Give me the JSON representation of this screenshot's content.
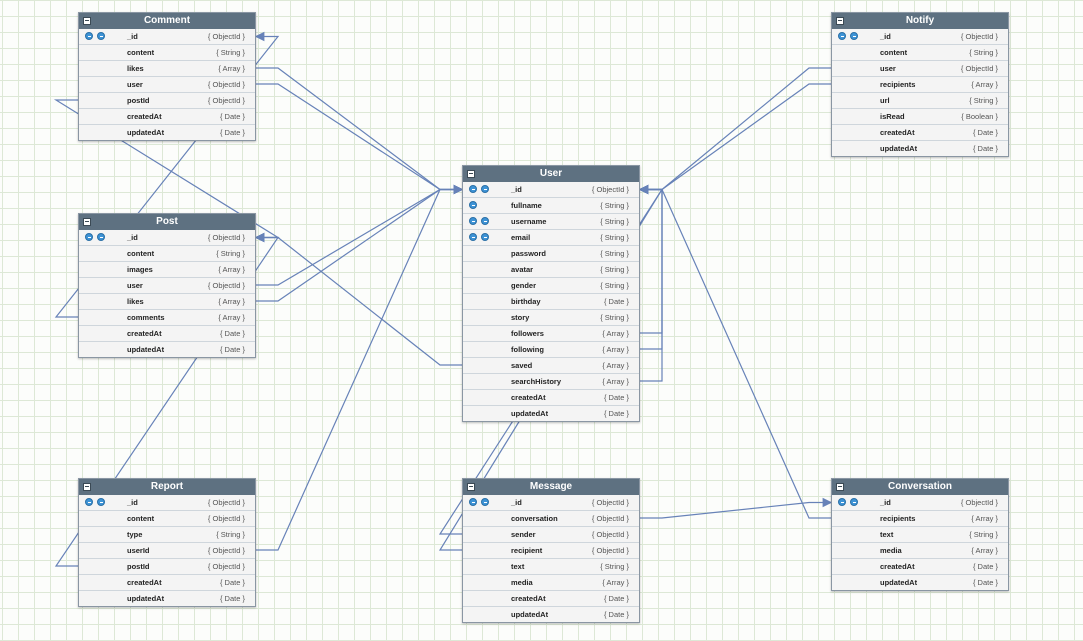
{
  "colors": {
    "header": "#5e7181",
    "wire": "#6782b8",
    "key": "#3d93d6",
    "grid": "#dde8d6"
  },
  "diagram": {
    "entities": [
      {
        "id": "comment",
        "name": "Comment",
        "fields": [
          {
            "name": "_id",
            "type": "{ ObjectId }",
            "keys": 2
          },
          {
            "name": "content",
            "type": "{ String }",
            "keys": 0
          },
          {
            "name": "likes",
            "type": "{ Array }",
            "keys": 0
          },
          {
            "name": "user",
            "type": "{ ObjectId }",
            "keys": 0
          },
          {
            "name": "postId",
            "type": "{ ObjectId }",
            "keys": 0
          },
          {
            "name": "createdAt",
            "type": "{ Date }",
            "keys": 0
          },
          {
            "name": "updatedAt",
            "type": "{ Date }",
            "keys": 0
          }
        ]
      },
      {
        "id": "post",
        "name": "Post",
        "fields": [
          {
            "name": "_id",
            "type": "{ ObjectId }",
            "keys": 2
          },
          {
            "name": "content",
            "type": "{ String }",
            "keys": 0
          },
          {
            "name": "images",
            "type": "{ Array }",
            "keys": 0
          },
          {
            "name": "user",
            "type": "{ ObjectId }",
            "keys": 0
          },
          {
            "name": "likes",
            "type": "{ Array }",
            "keys": 0
          },
          {
            "name": "comments",
            "type": "{ Array }",
            "keys": 0
          },
          {
            "name": "createdAt",
            "type": "{ Date }",
            "keys": 0
          },
          {
            "name": "updatedAt",
            "type": "{ Date }",
            "keys": 0
          }
        ]
      },
      {
        "id": "report",
        "name": "Report",
        "fields": [
          {
            "name": "_id",
            "type": "{ ObjectId }",
            "keys": 2
          },
          {
            "name": "content",
            "type": "{ ObjectId }",
            "keys": 0
          },
          {
            "name": "type",
            "type": "{ String }",
            "keys": 0
          },
          {
            "name": "userId",
            "type": "{ ObjectId }",
            "keys": 0
          },
          {
            "name": "postId",
            "type": "{ ObjectId }",
            "keys": 0
          },
          {
            "name": "createdAt",
            "type": "{ Date }",
            "keys": 0
          },
          {
            "name": "updatedAt",
            "type": "{ Date }",
            "keys": 0
          }
        ]
      },
      {
        "id": "user",
        "name": "User",
        "fields": [
          {
            "name": "_id",
            "type": "{ ObjectId }",
            "keys": 2
          },
          {
            "name": "fullname",
            "type": "{ String }",
            "keys": 1
          },
          {
            "name": "username",
            "type": "{ String }",
            "keys": 2
          },
          {
            "name": "email",
            "type": "{ String }",
            "keys": 2
          },
          {
            "name": "password",
            "type": "{ String }",
            "keys": 0
          },
          {
            "name": "avatar",
            "type": "{ String }",
            "keys": 0
          },
          {
            "name": "gender",
            "type": "{ String }",
            "keys": 0
          },
          {
            "name": "birthday",
            "type": "{ Date }",
            "keys": 0
          },
          {
            "name": "story",
            "type": "{ String }",
            "keys": 0
          },
          {
            "name": "followers",
            "type": "{ Array }",
            "keys": 0
          },
          {
            "name": "following",
            "type": "{ Array }",
            "keys": 0
          },
          {
            "name": "saved",
            "type": "{ Array }",
            "keys": 0
          },
          {
            "name": "searchHistory",
            "type": "{ Array }",
            "keys": 0
          },
          {
            "name": "createdAt",
            "type": "{ Date }",
            "keys": 0
          },
          {
            "name": "updatedAt",
            "type": "{ Date }",
            "keys": 0
          }
        ]
      },
      {
        "id": "message",
        "name": "Message",
        "fields": [
          {
            "name": "_id",
            "type": "{ ObjectId }",
            "keys": 2
          },
          {
            "name": "conversation",
            "type": "{ ObjectId }",
            "keys": 0
          },
          {
            "name": "sender",
            "type": "{ ObjectId }",
            "keys": 0
          },
          {
            "name": "recipient",
            "type": "{ ObjectId }",
            "keys": 0
          },
          {
            "name": "text",
            "type": "{ String }",
            "keys": 0
          },
          {
            "name": "media",
            "type": "{ Array }",
            "keys": 0
          },
          {
            "name": "createdAt",
            "type": "{ Date }",
            "keys": 0
          },
          {
            "name": "updatedAt",
            "type": "{ Date }",
            "keys": 0
          }
        ]
      },
      {
        "id": "notify",
        "name": "Notify",
        "fields": [
          {
            "name": "_id",
            "type": "{ ObjectId }",
            "keys": 2
          },
          {
            "name": "content",
            "type": "{ String }",
            "keys": 0
          },
          {
            "name": "user",
            "type": "{ ObjectId }",
            "keys": 0
          },
          {
            "name": "recipients",
            "type": "{ Array }",
            "keys": 0
          },
          {
            "name": "url",
            "type": "{ String }",
            "keys": 0
          },
          {
            "name": "isRead",
            "type": "{ Boolean }",
            "keys": 0
          },
          {
            "name": "createdAt",
            "type": "{ Date }",
            "keys": 0
          },
          {
            "name": "updatedAt",
            "type": "{ Date }",
            "keys": 0
          }
        ]
      },
      {
        "id": "conversation",
        "name": "Conversation",
        "fields": [
          {
            "name": "_id",
            "type": "{ ObjectId }",
            "keys": 2
          },
          {
            "name": "recipients",
            "type": "{ Array }",
            "keys": 0
          },
          {
            "name": "text",
            "type": "{ String }",
            "keys": 0
          },
          {
            "name": "media",
            "type": "{ Array }",
            "keys": 0
          },
          {
            "name": "createdAt",
            "type": "{ Date }",
            "keys": 0
          },
          {
            "name": "updatedAt",
            "type": "{ Date }",
            "keys": 0
          }
        ]
      }
    ],
    "relations": [
      {
        "from": "comment.likes",
        "to": "user._id"
      },
      {
        "from": "comment.user",
        "to": "user._id"
      },
      {
        "from": "comment.postId",
        "to": "post._id"
      },
      {
        "from": "post.user",
        "to": "user._id"
      },
      {
        "from": "post.likes",
        "to": "user._id"
      },
      {
        "from": "post.comments",
        "to": "comment._id"
      },
      {
        "from": "report.userId",
        "to": "user._id"
      },
      {
        "from": "report.postId",
        "to": "post._id"
      },
      {
        "from": "user.saved",
        "to": "post._id"
      },
      {
        "from": "user.followers",
        "to": "user._id"
      },
      {
        "from": "user.following",
        "to": "user._id"
      },
      {
        "from": "user.searchHistory",
        "to": "user._id"
      },
      {
        "from": "message.sender",
        "to": "user._id"
      },
      {
        "from": "message.recipient",
        "to": "user._id"
      },
      {
        "from": "message.conversation",
        "to": "conversation._id"
      },
      {
        "from": "conversation.recipients",
        "to": "user._id"
      },
      {
        "from": "notify.user",
        "to": "user._id"
      },
      {
        "from": "notify.recipients",
        "to": "user._id"
      }
    ]
  }
}
